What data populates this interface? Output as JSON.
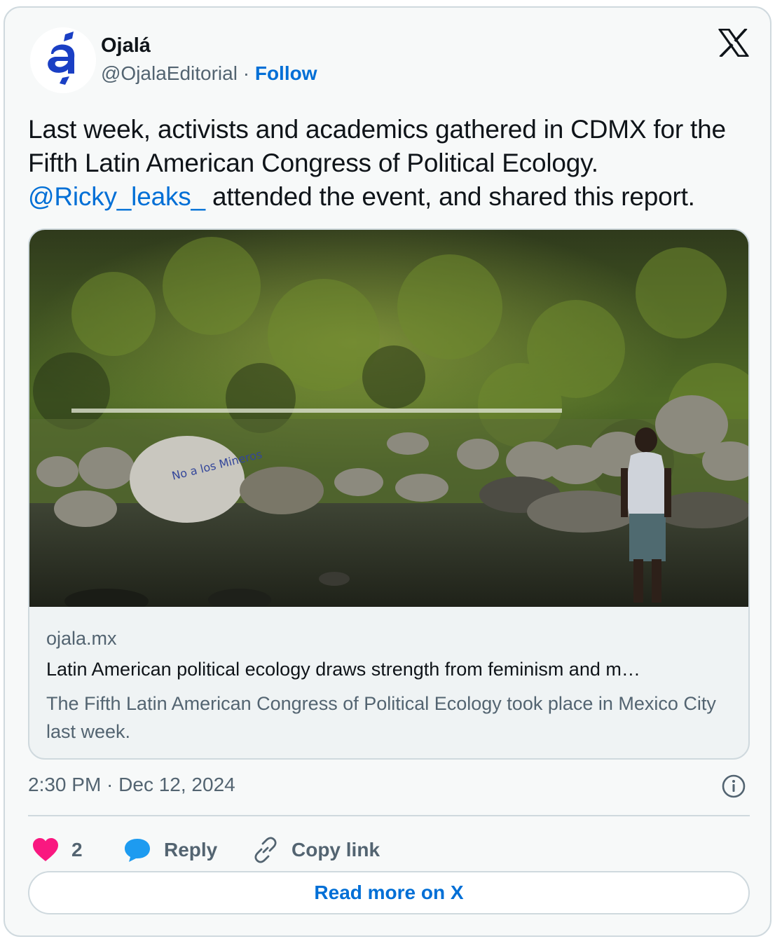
{
  "author": {
    "name": "Ojalá",
    "handle": "@OjalaEditorial",
    "separator": "·",
    "follow_label": "Follow",
    "avatar_icon": "ojala-logo-icon"
  },
  "platform_icon": "x-logo-icon",
  "tweet": {
    "text_before": "Last week, activists and academics gathered in CDMX for the Fifth Latin American Congress of Political Ecology. ",
    "mention": "@Ricky_leaks_",
    "text_after": " attended the event, and shared this report."
  },
  "link_card": {
    "image_alt_text": "No a los Mineros",
    "domain": "ojala.mx",
    "headline": "Latin American political ecology draws strength from feminism and m…",
    "description": "The Fifth Latin American Congress of Political Ecology took place in Mexico City last week."
  },
  "timestamp": "2:30 PM · Dec 12, 2024",
  "actions": {
    "like_count": "2",
    "reply_label": "Reply",
    "copy_link_label": "Copy link"
  },
  "read_more_label": "Read more on X",
  "colors": {
    "accent": "#006fd6",
    "like": "#f91880",
    "reply": "#1d9bf0",
    "muted": "#536471",
    "border": "#cfd9de"
  }
}
